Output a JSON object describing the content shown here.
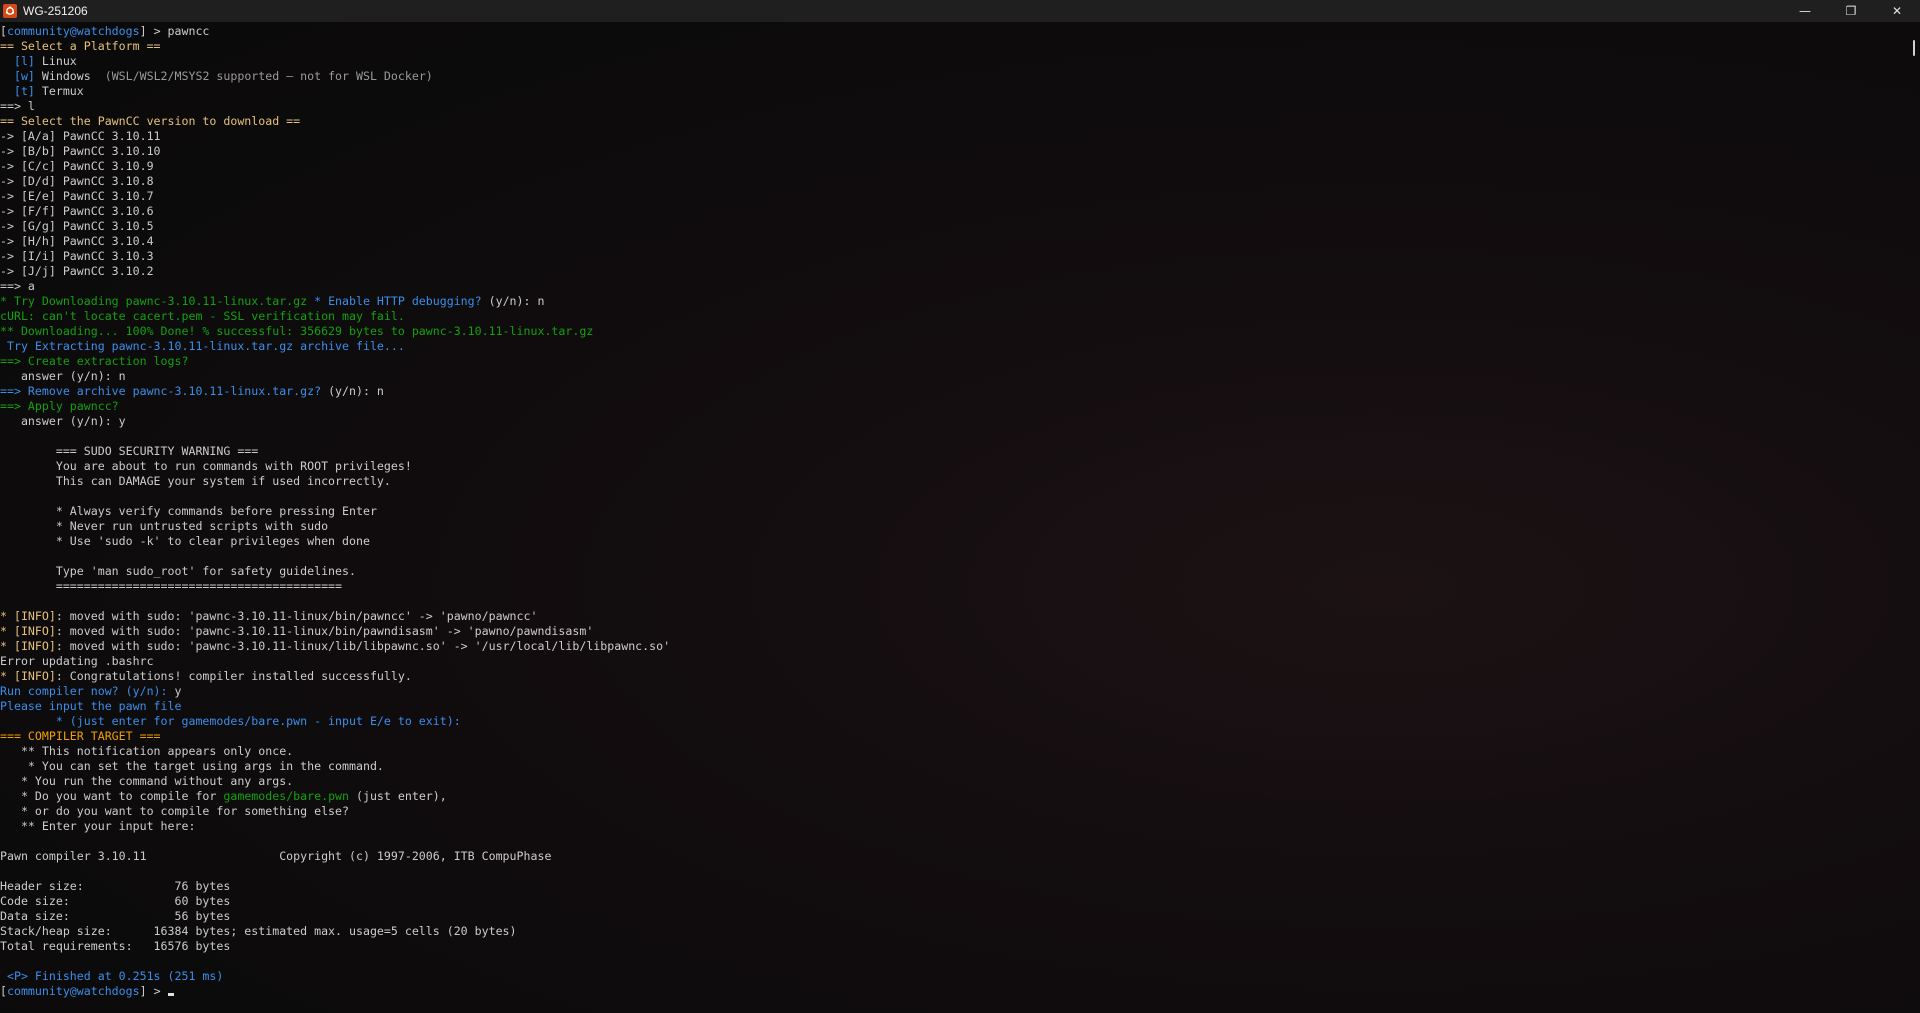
{
  "window": {
    "title": "WG-251206",
    "icon": "terminal-app-icon",
    "controls": {
      "minimize": "—",
      "restore": "❐",
      "close": "✕"
    }
  },
  "colors": {
    "prompt": "#3b8eea",
    "info": "#e5c07b",
    "success": "#13a10e"
  },
  "prompt": {
    "user_host": "community@watchdogs",
    "suffix": " > "
  },
  "terminal": {
    "lines": [
      [
        {
          "t": "[",
          "c": "default"
        },
        {
          "t": "community@watchdogs",
          "c": "blue"
        },
        {
          "t": "] > pawncc",
          "c": "default"
        }
      ],
      [
        {
          "t": "== Select a Platform ==",
          "c": "yellow"
        }
      ],
      [
        {
          "t": "  [l] ",
          "c": "blue"
        },
        {
          "t": "Linux",
          "c": "default"
        }
      ],
      [
        {
          "t": "  [w] ",
          "c": "blue"
        },
        {
          "t": "Windows  ",
          "c": "default"
        },
        {
          "t": "(WSL/WSL2/MSYS2 supported — not for WSL Docker)",
          "c": "gray"
        }
      ],
      [
        {
          "t": "  [t] ",
          "c": "blue"
        },
        {
          "t": "Termux",
          "c": "default"
        }
      ],
      [
        {
          "t": "==> l",
          "c": "default"
        }
      ],
      [
        {
          "t": "== Select the PawnCC version to download ==",
          "c": "yellow"
        }
      ],
      [
        {
          "t": "-> [A/a] PawnCC 3.10.11",
          "c": "default"
        }
      ],
      [
        {
          "t": "-> [B/b] PawnCC 3.10.10",
          "c": "default"
        }
      ],
      [
        {
          "t": "-> [C/c] PawnCC 3.10.9",
          "c": "default"
        }
      ],
      [
        {
          "t": "-> [D/d] PawnCC 3.10.8",
          "c": "default"
        }
      ],
      [
        {
          "t": "-> [E/e] PawnCC 3.10.7",
          "c": "default"
        }
      ],
      [
        {
          "t": "-> [F/f] PawnCC 3.10.6",
          "c": "default"
        }
      ],
      [
        {
          "t": "-> [G/g] PawnCC 3.10.5",
          "c": "default"
        }
      ],
      [
        {
          "t": "-> [H/h] PawnCC 3.10.4",
          "c": "default"
        }
      ],
      [
        {
          "t": "-> [I/i] PawnCC 3.10.3",
          "c": "default"
        }
      ],
      [
        {
          "t": "-> [J/j] PawnCC 3.10.2",
          "c": "default"
        }
      ],
      [
        {
          "t": "==> a",
          "c": "default"
        }
      ],
      [
        {
          "t": "* Try Downloading pawnc-3.10.11-linux.tar.gz",
          "c": "green"
        },
        {
          "t": " * Enable HTTP debugging? ",
          "c": "blue"
        },
        {
          "t": "(y/n): n",
          "c": "default"
        }
      ],
      [
        {
          "t": "cURL: can't locate cacert.pem - SSL verification may fail.",
          "c": "green"
        }
      ],
      [
        {
          "t": "** Downloading... 100% Done! % successful: 356629 bytes to pawnc-3.10.11-linux.tar.gz",
          "c": "green"
        }
      ],
      [
        {
          "t": " Try Extracting pawnc-3.10.11-linux.tar.gz archive file...",
          "c": "blue"
        }
      ],
      [
        {
          "t": "==> Create extraction logs?",
          "c": "green"
        }
      ],
      [
        {
          "t": "   answer (y/n): n",
          "c": "default"
        }
      ],
      [
        {
          "t": "==> Remove archive pawnc-3.10.11-linux.tar.gz? ",
          "c": "blue"
        },
        {
          "t": "(y/n): n",
          "c": "default"
        }
      ],
      [
        {
          "t": "==> Apply pawncc?",
          "c": "green"
        }
      ],
      [
        {
          "t": "   answer (y/n): y",
          "c": "default"
        }
      ],
      [
        {
          "t": "",
          "c": "default"
        }
      ],
      [
        {
          "t": "        === SUDO SECURITY WARNING ===",
          "c": "default"
        }
      ],
      [
        {
          "t": "        You are about to run commands with ROOT privileges!",
          "c": "default"
        }
      ],
      [
        {
          "t": "        This can DAMAGE your system if used incorrectly.",
          "c": "default"
        }
      ],
      [
        {
          "t": "",
          "c": "default"
        }
      ],
      [
        {
          "t": "        * Always verify commands before pressing Enter",
          "c": "default"
        }
      ],
      [
        {
          "t": "        * Never run untrusted scripts with sudo",
          "c": "default"
        }
      ],
      [
        {
          "t": "        * Use 'sudo -k' to clear privileges when done",
          "c": "default"
        }
      ],
      [
        {
          "t": "",
          "c": "default"
        }
      ],
      [
        {
          "t": "        Type 'man sudo_root' for safety guidelines.",
          "c": "default"
        }
      ],
      [
        {
          "t": "        =========================================",
          "c": "default"
        }
      ],
      [
        {
          "t": "",
          "c": "default"
        }
      ],
      [
        {
          "t": "* [INFO]",
          "c": "yellow"
        },
        {
          "t": ": moved with sudo: 'pawnc-3.10.11-linux/bin/pawncc' -> 'pawno/pawncc'",
          "c": "default"
        }
      ],
      [
        {
          "t": "* [INFO]",
          "c": "yellow"
        },
        {
          "t": ": moved with sudo: 'pawnc-3.10.11-linux/bin/pawndisasm' -> 'pawno/pawndisasm'",
          "c": "default"
        }
      ],
      [
        {
          "t": "* [INFO]",
          "c": "yellow"
        },
        {
          "t": ": moved with sudo: 'pawnc-3.10.11-linux/lib/libpawnc.so' -> '/usr/local/lib/libpawnc.so'",
          "c": "default"
        }
      ],
      [
        {
          "t": "Error updating .bashrc",
          "c": "default"
        }
      ],
      [
        {
          "t": "* [INFO]",
          "c": "yellow"
        },
        {
          "t": ": Congratulations! compiler installed successfully.",
          "c": "default"
        }
      ],
      [
        {
          "t": "Run compiler now? (y/n): ",
          "c": "blue"
        },
        {
          "t": "y",
          "c": "default"
        }
      ],
      [
        {
          "t": "Please input the pawn file",
          "c": "blue"
        }
      ],
      [
        {
          "t": "        * (just enter for gamemodes/bare.pwn - input E/e to exit):",
          "c": "blue"
        }
      ],
      [
        {
          "t": "=== COMPILER TARGET ===",
          "c": "orange"
        }
      ],
      [
        {
          "t": "   ** This notification appears only once.",
          "c": "default"
        }
      ],
      [
        {
          "t": "    * You can set the target using args in the command.",
          "c": "default"
        }
      ],
      [
        {
          "t": "   * You run the command without any args.",
          "c": "default"
        }
      ],
      [
        {
          "t": "   * Do you want to compile for ",
          "c": "default"
        },
        {
          "t": "gamemodes/bare.pwn",
          "c": "green"
        },
        {
          "t": " (just enter),",
          "c": "default"
        }
      ],
      [
        {
          "t": "   * or do you want to compile for something else?",
          "c": "default"
        }
      ],
      [
        {
          "t": "   ** Enter your input here:",
          "c": "default"
        }
      ],
      [
        {
          "t": "",
          "c": "default"
        }
      ],
      [
        {
          "t": "Pawn compiler 3.10.11                   Copyright (c) 1997-2006, ITB CompuPhase",
          "c": "default"
        }
      ],
      [
        {
          "t": "",
          "c": "default"
        }
      ],
      [
        {
          "t": "Header size:             76 bytes",
          "c": "default"
        }
      ],
      [
        {
          "t": "Code size:               60 bytes",
          "c": "default"
        }
      ],
      [
        {
          "t": "Data size:               56 bytes",
          "c": "default"
        }
      ],
      [
        {
          "t": "Stack/heap size:      16384 bytes; estimated max. usage=5 cells (20 bytes)",
          "c": "default"
        }
      ],
      [
        {
          "t": "Total requirements:   16576 bytes",
          "c": "default"
        }
      ],
      [
        {
          "t": "",
          "c": "default"
        }
      ],
      [
        {
          "t": " <P> Finished at 0.251s (251 ms)",
          "c": "blue"
        }
      ],
      [
        {
          "t": "[",
          "c": "default"
        },
        {
          "t": "community@watchdogs",
          "c": "blue"
        },
        {
          "t": "] > ",
          "c": "default"
        }
      ]
    ]
  }
}
